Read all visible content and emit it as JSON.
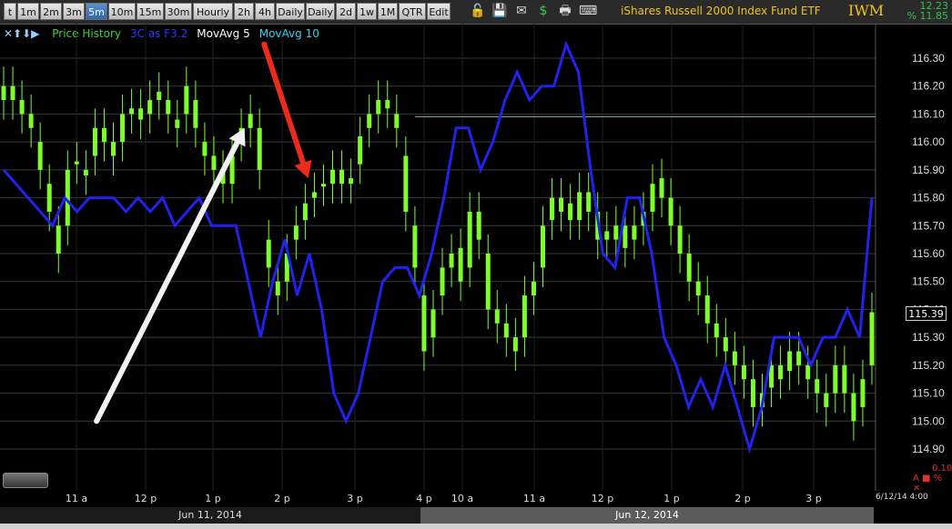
{
  "toolbar": {
    "buttons": [
      {
        "label": "t",
        "active": false
      },
      {
        "label": "1m",
        "active": false
      },
      {
        "label": "2m",
        "active": false
      },
      {
        "label": "3m",
        "active": false
      },
      {
        "label": "5m",
        "active": true
      },
      {
        "label": "10m",
        "active": false
      },
      {
        "label": "15m",
        "active": false
      },
      {
        "label": "30m",
        "active": false
      },
      {
        "label": "Hourly",
        "active": false
      },
      {
        "label": "2h",
        "active": false
      },
      {
        "label": "4h",
        "active": false
      },
      {
        "label": "Daily",
        "active": false
      },
      {
        "label": "Daily",
        "active": false
      },
      {
        "label": "2d",
        "active": false
      },
      {
        "label": "1w",
        "active": false
      },
      {
        "label": "1M",
        "active": false
      },
      {
        "label": "QTR",
        "active": false
      },
      {
        "label": "Edit",
        "active": false
      }
    ],
    "icons": [
      "padlock-icon",
      "save-icon",
      "mail-icon",
      "dollar-icon",
      "print-icon",
      "keyboard-icon"
    ],
    "instrument_name": "iShares Russell 2000 Index Fund ETF",
    "symbol": "IWM",
    "change_value": "12.23",
    "change_pct": "% 11.85"
  },
  "legend": {
    "nav_icons": "✕⬆⬇▶",
    "items": [
      {
        "label": "Price History",
        "color": "#3bd13b"
      },
      {
        "label": "3C as F3.2",
        "color": "#3333ff"
      },
      {
        "label": "MovAvg 5",
        "color": "#ffffff"
      },
      {
        "label": "MovAvg 10",
        "color": "#35d0f0"
      }
    ]
  },
  "last_price": "115.39",
  "indicator_value": "0.10",
  "indicator_mark": "A ■ % ✕",
  "timestamp": "6/12/14 4:00",
  "dates": {
    "day1": "Jun 11, 2014",
    "day2": "Jun 12, 2014"
  },
  "colors": {
    "candle": "#7dff2a",
    "three_c": "#2222ee",
    "arrow_up": "#f2f2f2",
    "arrow_down": "#ee2a1a",
    "grid": "#3a3a3a"
  },
  "chart_data": {
    "type": "candlestick",
    "title": "iShares Russell 2000 Index Fund ETF",
    "ylim": [
      114.8,
      116.4
    ],
    "y_ticks": [
      "116.30",
      "116.20",
      "116.10",
      "116.00",
      "115.90",
      "115.80",
      "115.70",
      "115.60",
      "115.50",
      "115.40",
      "115.30",
      "115.20",
      "115.10",
      "115.00",
      "114.90"
    ],
    "x_ticks": [
      "11 a",
      "12 p",
      "1 p",
      "2 p",
      "3 p",
      "4 p",
      "10 a",
      "11 a",
      "12 p",
      "1 p",
      "2 p",
      "3 p"
    ],
    "reference_line": 116.09,
    "close": [
      116.15,
      116.2,
      116.1,
      116.05,
      115.9,
      115.75,
      115.6,
      115.9,
      115.93,
      115.88,
      116.05,
      116.0,
      115.95,
      116.1,
      116.12,
      116.08,
      116.15,
      116.18,
      116.1,
      116.05,
      116.2,
      116.05,
      115.95,
      115.9,
      115.85,
      115.95,
      116.05,
      116.1,
      115.9,
      115.55,
      115.45,
      115.6,
      115.7,
      115.78,
      115.82,
      115.85,
      115.9,
      115.85,
      115.87,
      116.02,
      116.1,
      116.15,
      116.12,
      116.05,
      115.75,
      115.55,
      115.25,
      115.4,
      115.55,
      115.6,
      115.5,
      115.75,
      115.65,
      115.4,
      115.35,
      115.3,
      115.25,
      115.45,
      115.5,
      115.7,
      115.8,
      115.75,
      115.72,
      115.82,
      115.75,
      115.65,
      115.68,
      115.7,
      115.62,
      115.7,
      115.75,
      115.85,
      115.8,
      115.7,
      115.6,
      115.5,
      115.45,
      115.35,
      115.3,
      115.25,
      115.2,
      115.15,
      115.05,
      115.1,
      115.2,
      115.15,
      115.25,
      115.2,
      115.15,
      115.1,
      115.05,
      115.2,
      115.1,
      115.0,
      115.15,
      115.39
    ],
    "open": [
      116.2,
      116.15,
      116.15,
      116.1,
      116.0,
      115.85,
      115.7,
      115.7,
      115.92,
      115.9,
      115.95,
      116.05,
      116.0,
      116.0,
      116.1,
      116.12,
      116.1,
      116.15,
      116.15,
      116.08,
      116.1,
      116.15,
      116.0,
      115.95,
      115.9,
      115.85,
      116.0,
      116.05,
      116.05,
      115.65,
      115.5,
      115.5,
      115.65,
      115.72,
      115.8,
      115.84,
      115.85,
      115.9,
      115.85,
      115.92,
      116.05,
      116.1,
      116.15,
      116.1,
      115.95,
      115.7,
      115.45,
      115.3,
      115.45,
      115.55,
      115.62,
      115.55,
      115.75,
      115.6,
      115.4,
      115.35,
      115.3,
      115.3,
      115.45,
      115.55,
      115.72,
      115.8,
      115.78,
      115.72,
      115.82,
      115.75,
      115.65,
      115.65,
      115.7,
      115.65,
      115.7,
      115.75,
      115.87,
      115.8,
      115.7,
      115.6,
      115.5,
      115.45,
      115.35,
      115.3,
      115.25,
      115.2,
      115.15,
      115.05,
      115.12,
      115.2,
      115.18,
      115.25,
      115.2,
      115.15,
      115.1,
      115.1,
      115.2,
      115.1,
      115.05,
      115.2
    ],
    "series": [
      {
        "name": "3C as F3.2",
        "color": "#2222ee",
        "values": [
          115.9,
          115.85,
          115.8,
          115.75,
          115.7,
          115.8,
          115.75,
          115.8,
          115.8,
          115.8,
          115.75,
          115.8,
          115.75,
          115.8,
          115.7,
          115.75,
          115.8,
          115.7,
          115.7,
          115.7,
          115.5,
          115.3,
          115.5,
          115.65,
          115.45,
          115.6,
          115.4,
          115.1,
          115.0,
          115.1,
          115.3,
          115.5,
          115.55,
          115.55,
          115.45,
          115.6,
          115.8,
          116.05,
          116.05,
          115.9,
          116.0,
          116.15,
          116.25,
          116.15,
          116.2,
          116.2,
          116.35,
          116.25,
          115.9,
          115.6,
          115.55,
          115.8,
          115.8,
          115.6,
          115.3,
          115.2,
          115.05,
          115.15,
          115.05,
          115.2,
          115.05,
          114.9,
          115.05,
          115.3,
          115.3,
          115.3,
          115.2,
          115.3,
          115.3,
          115.4,
          115.3,
          115.8
        ]
      }
    ],
    "annotations": [
      {
        "type": "arrow",
        "color": "white",
        "from": {
          "xi": 7.6,
          "y": 115.0
        },
        "to": {
          "xi": 19.7,
          "y": 116.05
        }
      },
      {
        "type": "arrow",
        "color": "red",
        "from": {
          "xi": 21.3,
          "y": 116.35
        },
        "to": {
          "xi": 24.9,
          "y": 115.87
        }
      }
    ]
  }
}
